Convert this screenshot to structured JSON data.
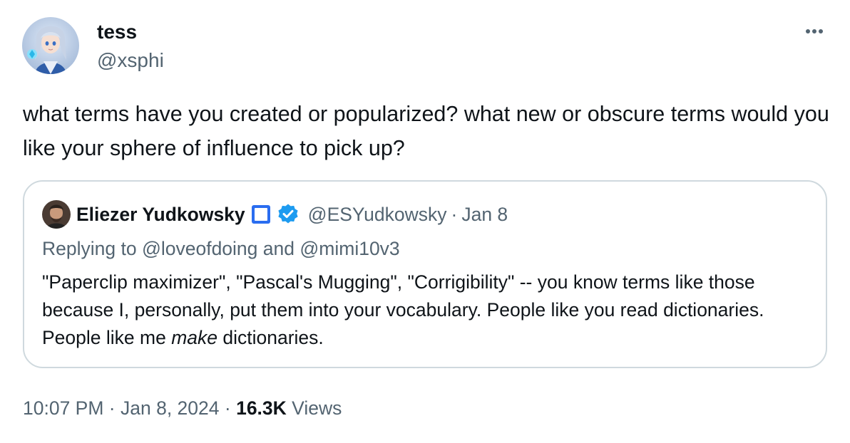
{
  "author": {
    "name": "tess",
    "handle": "@xsphi",
    "avatar_icon": "anime-avatar"
  },
  "tweet": {
    "text": "what terms have you created or popularized? what new or obscure terms would you like your sphere of influence to pick up?"
  },
  "quoted_tweet": {
    "author_name": "Eliezer Yudkowsky",
    "name_emoji": "blue-square",
    "verified": true,
    "handle": "@ESYudkowsky",
    "separator": "·",
    "date": "Jan 8",
    "replying_prefix": "Replying to ",
    "replying_to": [
      "@loveofdoing",
      "@mimi10v3"
    ],
    "replying_joiner": " and ",
    "text_before_emphasis": "\"Paperclip maximizer\", \"Pascal's Mugging\", \"Corrigibility\" -- you know terms like those because I, personally, put them into your vocabulary.  People like you read dictionaries.  People like me ",
    "text_emphasis": "make",
    "text_after_emphasis": " dictionaries."
  },
  "meta": {
    "time": "10:07 PM",
    "separator": " · ",
    "date": "Jan 8, 2024",
    "views_count": "16.3K",
    "views_label": " Views"
  },
  "colors": {
    "text_primary": "#0f1419",
    "text_secondary": "#536471",
    "border": "#cfd9de",
    "verified_blue": "#1d9bf0",
    "square_blue": "#2a6df0"
  }
}
